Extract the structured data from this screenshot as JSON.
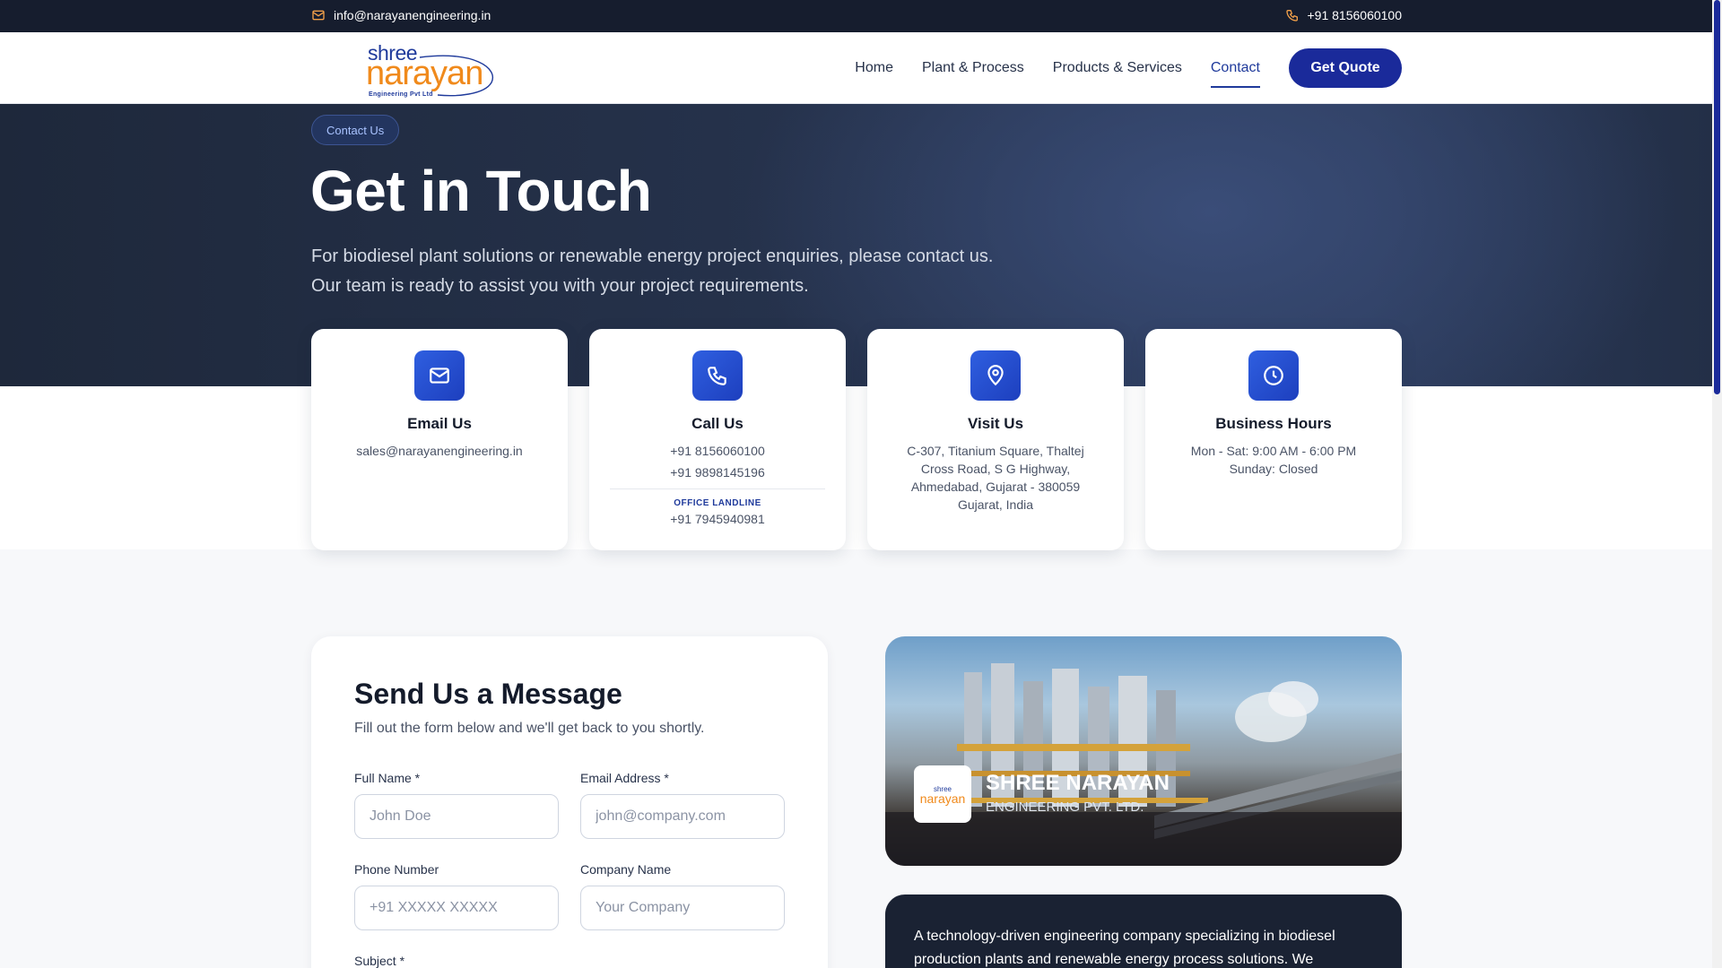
{
  "topbar": {
    "email": "info@narayanengineering.in",
    "phone": "+91 8156060100"
  },
  "logo": {
    "line1": "shree",
    "line2": "narayan",
    "line3": "Engineering Pvt Ltd"
  },
  "nav": {
    "items": [
      {
        "label": "Home"
      },
      {
        "label": "Plant & Process"
      },
      {
        "label": "Products & Services"
      },
      {
        "label": "Contact"
      }
    ],
    "active": "Contact",
    "cta": "Get Quote"
  },
  "hero": {
    "badge": "Contact Us",
    "title": "Get in Touch",
    "description": "For biodiesel plant solutions or renewable energy project enquiries, please contact us. Our team is ready to assist you with your project requirements."
  },
  "cards": {
    "email": {
      "title": "Email Us",
      "line1": "sales@narayanengineering.in"
    },
    "call": {
      "title": "Call Us",
      "line1": "+91 8156060100",
      "line2": "+91 9898145196",
      "landline_label": "OFFICE LANDLINE",
      "landline": "+91 7945940981"
    },
    "visit": {
      "title": "Visit Us",
      "line1": "C-307, Titanium Square, Thaltej",
      "line2": "Cross Road, S G Highway,",
      "line3": "Ahmedabad, Gujarat - 380059",
      "line4": "Gujarat, India"
    },
    "hours": {
      "title": "Business Hours",
      "line1": "Mon - Sat: 9:00 AM - 6:00 PM",
      "line2": "Sunday: Closed"
    }
  },
  "form": {
    "title": "Send Us a Message",
    "subtitle": "Fill out the form below and we'll get back to you shortly.",
    "full_name": {
      "label": "Full Name *",
      "placeholder": "John Doe"
    },
    "email": {
      "label": "Email Address *",
      "placeholder": "john@company.com"
    },
    "phone": {
      "label": "Phone Number",
      "placeholder": "+91 XXXXX XXXXX"
    },
    "company": {
      "label": "Company Name",
      "placeholder": "Your Company"
    },
    "subject": {
      "label": "Subject *"
    }
  },
  "brand": {
    "logo_small_1": "shree",
    "logo_small_2": "narayan",
    "name": "SHREE NARAYAN",
    "sub": "ENGINEERING PVT. LTD."
  },
  "about": {
    "text": "A technology-driven engineering company specializing in biodiesel production plants and renewable energy process solutions. We"
  },
  "colors": {
    "primary": "#1a2a9a",
    "accent": "#f08a1c",
    "dark": "#161d2e"
  }
}
